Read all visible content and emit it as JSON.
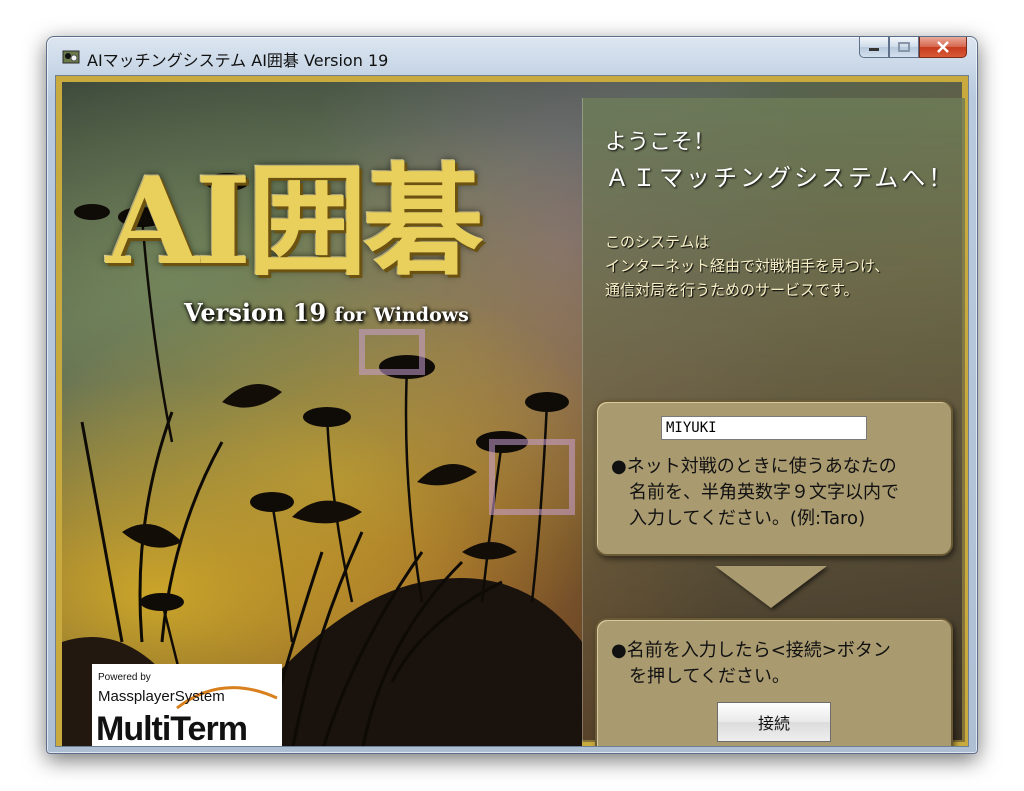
{
  "window": {
    "title": "AIマッチングシステム AI囲碁 Version 19",
    "icon": "go-board-app-icon",
    "controls": [
      "minimize",
      "maximize",
      "close"
    ]
  },
  "logo": {
    "main": "AI囲碁",
    "sub_version": "Version 19",
    "sub_for": "for",
    "sub_windows": "Windows"
  },
  "powered": {
    "powered_by": "Powered by",
    "system": "MassplayerSystem",
    "brand": "MultiTerm"
  },
  "panel": {
    "welcome1": "ようこそ！",
    "welcome2": "ＡＩマッチングシステムへ！",
    "desc": [
      "このシステムは",
      "インターネット経由で対戦相手を見つけ、",
      "通信対局を行うためのサービスです。"
    ],
    "name_box": {
      "input_value": "MIYUKI",
      "text": [
        "●ネット対戦のときに使うあなたの",
        "名前を、半角英数字９文字以内で",
        "入力してください。(例:Taro)"
      ]
    },
    "connect_box": {
      "text": [
        "●名前を入力したら<接続>ボタン",
        "を押してください。"
      ],
      "button_label": "接続"
    }
  },
  "colors": {
    "frame_gold": "#c8aa3e",
    "box_fill": "#a99a70",
    "logo_gold": "#e9cf5c"
  }
}
